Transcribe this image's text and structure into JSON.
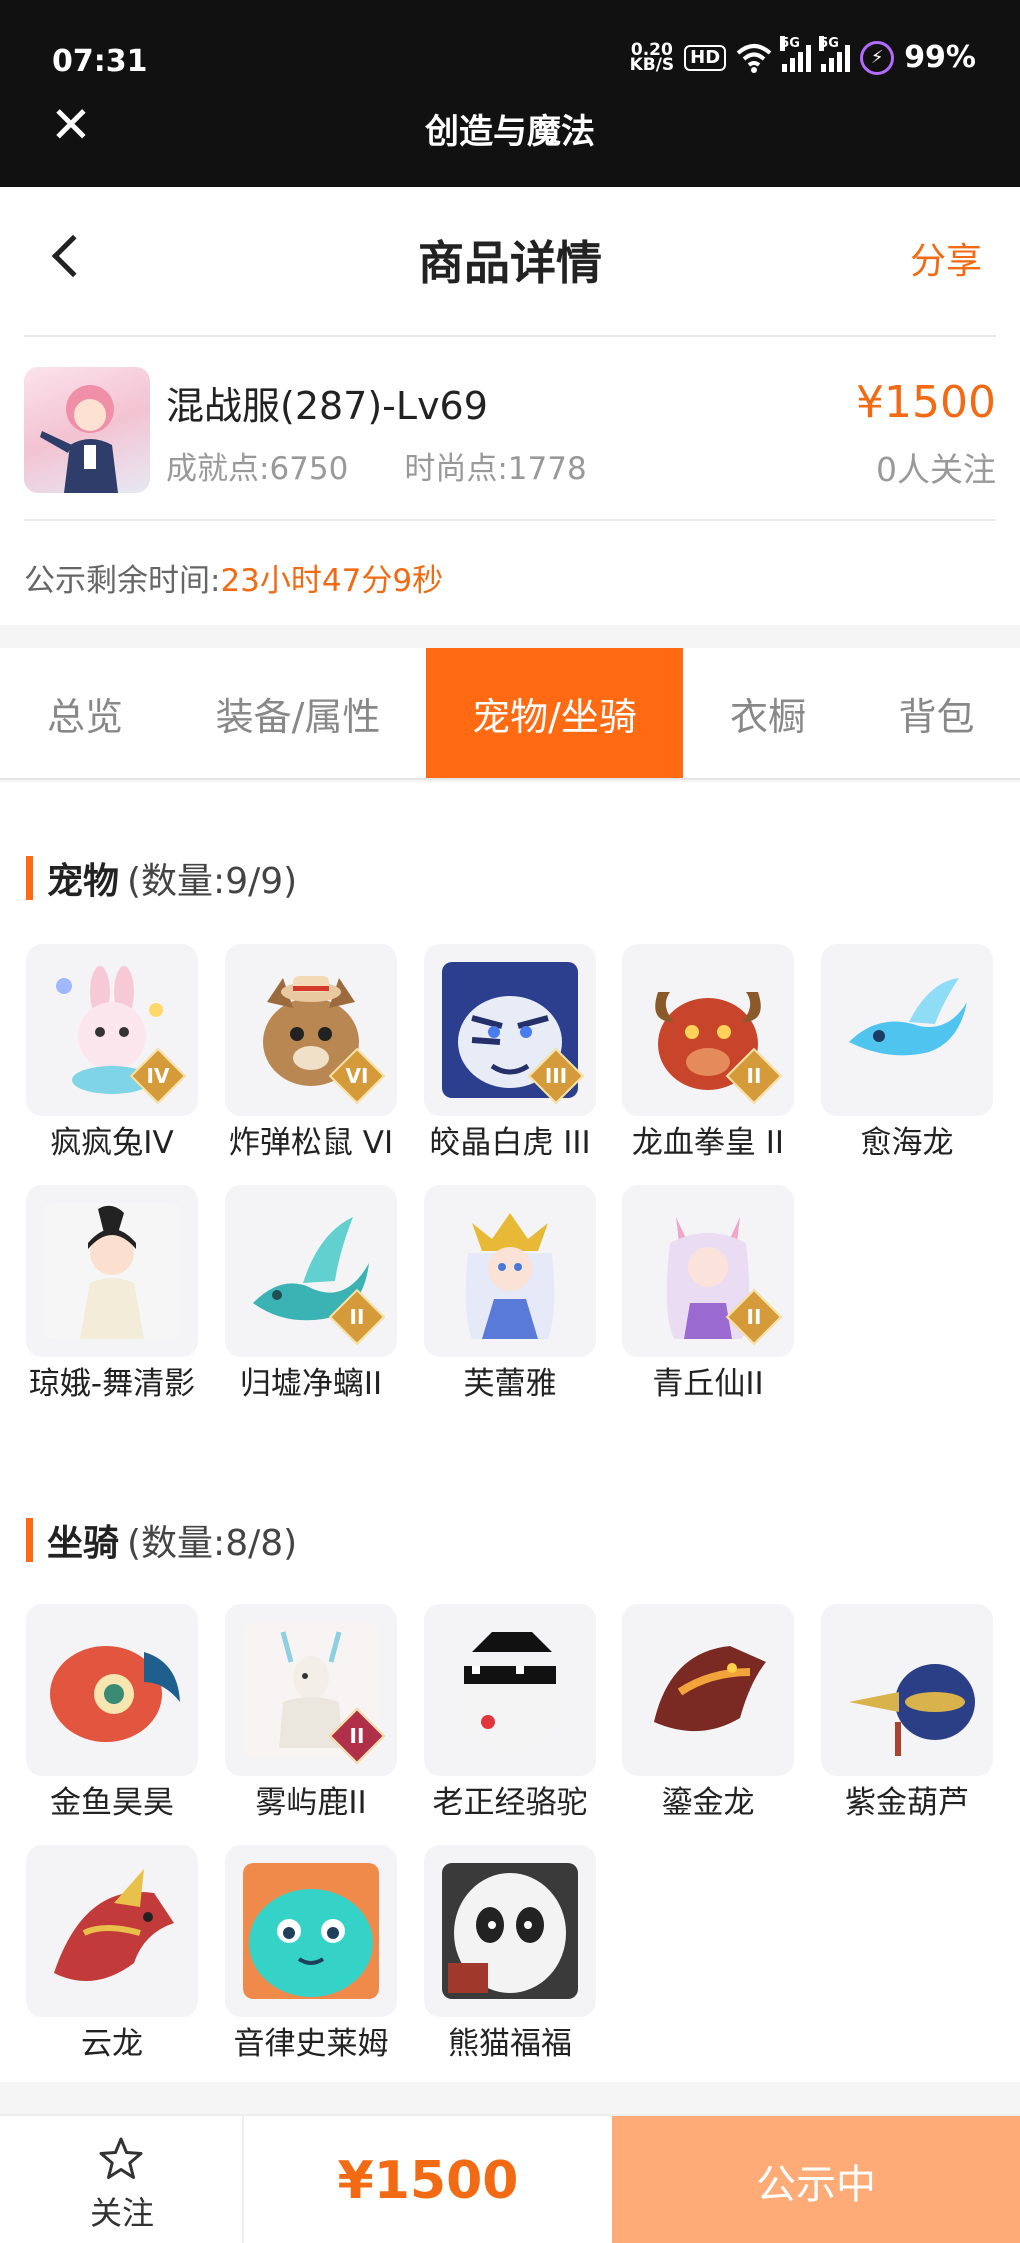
{
  "status_bar": {
    "time": "07:31",
    "net_speed_value": "0.20",
    "net_speed_unit": "KB/S",
    "hd": "HD",
    "sim1_label": "5G",
    "sim2_label": "5G",
    "battery": "99%"
  },
  "app_bar": {
    "title": "创造与魔法"
  },
  "header": {
    "title": "商品详情",
    "share": "分享"
  },
  "product": {
    "name": "混战服(287)-Lv69",
    "achievement": "成就点:6750",
    "fashion": "时尚点:1778",
    "price": "¥1500",
    "followers": "0人关注",
    "countdown_label": "公示剩余时间:",
    "countdown_value": "23小时47分9秒"
  },
  "tabs": [
    {
      "label": "总览",
      "active": false
    },
    {
      "label": "装备/属性",
      "active": false
    },
    {
      "label": "宠物/坐骑",
      "active": true
    },
    {
      "label": "衣橱",
      "active": false
    },
    {
      "label": "背包",
      "active": false
    }
  ],
  "pets": {
    "title": "宠物",
    "count": "(数量:9/9)",
    "items": [
      {
        "label": "疯疯兔IV"
      },
      {
        "label": "炸弹松鼠 VI"
      },
      {
        "label": "皎晶白虎 III"
      },
      {
        "label": "龙血拳皇 II"
      },
      {
        "label": "愈海龙"
      },
      {
        "label": "琼娥-舞清影"
      },
      {
        "label": "归墟净螭II"
      },
      {
        "label": "芙蕾雅"
      },
      {
        "label": "青丘仙II"
      }
    ]
  },
  "mounts": {
    "title": "坐骑",
    "count": "(数量:8/8)",
    "items": [
      {
        "label": "金鱼昊昊"
      },
      {
        "label": "雾屿鹿II"
      },
      {
        "label": "老正经骆驼"
      },
      {
        "label": "鎏金龙"
      },
      {
        "label": "紫金葫芦"
      },
      {
        "label": "云龙"
      },
      {
        "label": "音律史莱姆"
      },
      {
        "label": "熊猫福福"
      }
    ]
  },
  "bottom_bar": {
    "follow": "关注",
    "price": "¥1500",
    "status": "公示中"
  },
  "colors": {
    "accent": "#ff6a13",
    "price": "#f26a14",
    "status_button": "#ffab78"
  }
}
